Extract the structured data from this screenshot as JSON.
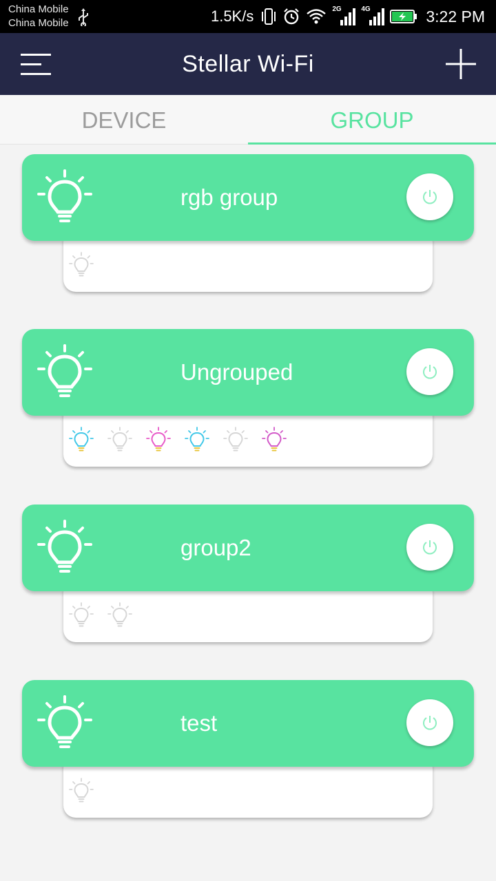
{
  "status_bar": {
    "carrier_1": "China Mobile",
    "carrier_2": "China Mobile",
    "speed": "1.5K/s",
    "net_label_1": "2G",
    "net_label_2": "4G",
    "time": "3:22 PM"
  },
  "app_bar": {
    "title": "Stellar Wi-Fi"
  },
  "tabs": [
    {
      "label": "DEVICE",
      "active": false
    },
    {
      "label": "GROUP",
      "active": true
    }
  ],
  "colors": {
    "accent": "#58e3a0",
    "app_bar": "#252847",
    "tab_inactive": "#9b9b9b",
    "bulb_off": "#d6d6d6"
  },
  "groups": [
    {
      "name": "rgb group",
      "devices": [
        {
          "icon": "bulb-off-icon",
          "color": "#d6d6d6"
        }
      ]
    },
    {
      "name": "Ungrouped",
      "devices": [
        {
          "icon": "bulb-rgb-icon",
          "color": "#42c8e8"
        },
        {
          "icon": "bulb-off-icon",
          "color": "#d6d6d6"
        },
        {
          "icon": "bulb-rgb-icon",
          "color": "#e85ac8"
        },
        {
          "icon": "bulb-rgb-icon",
          "color": "#42c8e8"
        },
        {
          "icon": "bulb-off-icon",
          "color": "#d6d6d6"
        },
        {
          "icon": "bulb-rgb-icon",
          "color": "#d25ac8"
        }
      ]
    },
    {
      "name": "group2",
      "devices": [
        {
          "icon": "bulb-off-icon",
          "color": "#d6d6d6"
        },
        {
          "icon": "bulb-off-icon",
          "color": "#d6d6d6"
        }
      ]
    },
    {
      "name": "test",
      "devices": [
        {
          "icon": "bulb-off-icon",
          "color": "#d6d6d6"
        }
      ]
    }
  ]
}
